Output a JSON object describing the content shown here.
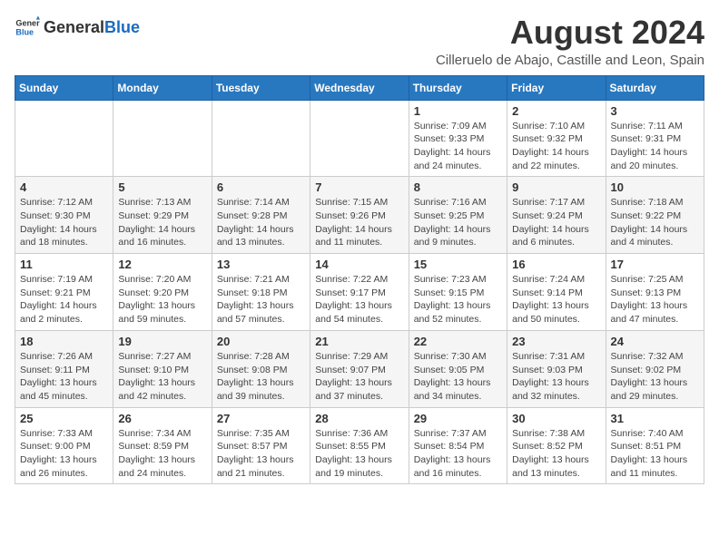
{
  "header": {
    "logo_general": "General",
    "logo_blue": "Blue",
    "main_title": "August 2024",
    "subtitle": "Cilleruelo de Abajo, Castille and Leon, Spain"
  },
  "weekdays": [
    "Sunday",
    "Monday",
    "Tuesday",
    "Wednesday",
    "Thursday",
    "Friday",
    "Saturday"
  ],
  "weeks": [
    [
      {
        "day": "",
        "info": ""
      },
      {
        "day": "",
        "info": ""
      },
      {
        "day": "",
        "info": ""
      },
      {
        "day": "",
        "info": ""
      },
      {
        "day": "1",
        "info": "Sunrise: 7:09 AM\nSunset: 9:33 PM\nDaylight: 14 hours\nand 24 minutes."
      },
      {
        "day": "2",
        "info": "Sunrise: 7:10 AM\nSunset: 9:32 PM\nDaylight: 14 hours\nand 22 minutes."
      },
      {
        "day": "3",
        "info": "Sunrise: 7:11 AM\nSunset: 9:31 PM\nDaylight: 14 hours\nand 20 minutes."
      }
    ],
    [
      {
        "day": "4",
        "info": "Sunrise: 7:12 AM\nSunset: 9:30 PM\nDaylight: 14 hours\nand 18 minutes."
      },
      {
        "day": "5",
        "info": "Sunrise: 7:13 AM\nSunset: 9:29 PM\nDaylight: 14 hours\nand 16 minutes."
      },
      {
        "day": "6",
        "info": "Sunrise: 7:14 AM\nSunset: 9:28 PM\nDaylight: 14 hours\nand 13 minutes."
      },
      {
        "day": "7",
        "info": "Sunrise: 7:15 AM\nSunset: 9:26 PM\nDaylight: 14 hours\nand 11 minutes."
      },
      {
        "day": "8",
        "info": "Sunrise: 7:16 AM\nSunset: 9:25 PM\nDaylight: 14 hours\nand 9 minutes."
      },
      {
        "day": "9",
        "info": "Sunrise: 7:17 AM\nSunset: 9:24 PM\nDaylight: 14 hours\nand 6 minutes."
      },
      {
        "day": "10",
        "info": "Sunrise: 7:18 AM\nSunset: 9:22 PM\nDaylight: 14 hours\nand 4 minutes."
      }
    ],
    [
      {
        "day": "11",
        "info": "Sunrise: 7:19 AM\nSunset: 9:21 PM\nDaylight: 14 hours\nand 2 minutes."
      },
      {
        "day": "12",
        "info": "Sunrise: 7:20 AM\nSunset: 9:20 PM\nDaylight: 13 hours\nand 59 minutes."
      },
      {
        "day": "13",
        "info": "Sunrise: 7:21 AM\nSunset: 9:18 PM\nDaylight: 13 hours\nand 57 minutes."
      },
      {
        "day": "14",
        "info": "Sunrise: 7:22 AM\nSunset: 9:17 PM\nDaylight: 13 hours\nand 54 minutes."
      },
      {
        "day": "15",
        "info": "Sunrise: 7:23 AM\nSunset: 9:15 PM\nDaylight: 13 hours\nand 52 minutes."
      },
      {
        "day": "16",
        "info": "Sunrise: 7:24 AM\nSunset: 9:14 PM\nDaylight: 13 hours\nand 50 minutes."
      },
      {
        "day": "17",
        "info": "Sunrise: 7:25 AM\nSunset: 9:13 PM\nDaylight: 13 hours\nand 47 minutes."
      }
    ],
    [
      {
        "day": "18",
        "info": "Sunrise: 7:26 AM\nSunset: 9:11 PM\nDaylight: 13 hours\nand 45 minutes."
      },
      {
        "day": "19",
        "info": "Sunrise: 7:27 AM\nSunset: 9:10 PM\nDaylight: 13 hours\nand 42 minutes."
      },
      {
        "day": "20",
        "info": "Sunrise: 7:28 AM\nSunset: 9:08 PM\nDaylight: 13 hours\nand 39 minutes."
      },
      {
        "day": "21",
        "info": "Sunrise: 7:29 AM\nSunset: 9:07 PM\nDaylight: 13 hours\nand 37 minutes."
      },
      {
        "day": "22",
        "info": "Sunrise: 7:30 AM\nSunset: 9:05 PM\nDaylight: 13 hours\nand 34 minutes."
      },
      {
        "day": "23",
        "info": "Sunrise: 7:31 AM\nSunset: 9:03 PM\nDaylight: 13 hours\nand 32 minutes."
      },
      {
        "day": "24",
        "info": "Sunrise: 7:32 AM\nSunset: 9:02 PM\nDaylight: 13 hours\nand 29 minutes."
      }
    ],
    [
      {
        "day": "25",
        "info": "Sunrise: 7:33 AM\nSunset: 9:00 PM\nDaylight: 13 hours\nand 26 minutes."
      },
      {
        "day": "26",
        "info": "Sunrise: 7:34 AM\nSunset: 8:59 PM\nDaylight: 13 hours\nand 24 minutes."
      },
      {
        "day": "27",
        "info": "Sunrise: 7:35 AM\nSunset: 8:57 PM\nDaylight: 13 hours\nand 21 minutes."
      },
      {
        "day": "28",
        "info": "Sunrise: 7:36 AM\nSunset: 8:55 PM\nDaylight: 13 hours\nand 19 minutes."
      },
      {
        "day": "29",
        "info": "Sunrise: 7:37 AM\nSunset: 8:54 PM\nDaylight: 13 hours\nand 16 minutes."
      },
      {
        "day": "30",
        "info": "Sunrise: 7:38 AM\nSunset: 8:52 PM\nDaylight: 13 hours\nand 13 minutes."
      },
      {
        "day": "31",
        "info": "Sunrise: 7:40 AM\nSunset: 8:51 PM\nDaylight: 13 hours\nand 11 minutes."
      }
    ]
  ]
}
